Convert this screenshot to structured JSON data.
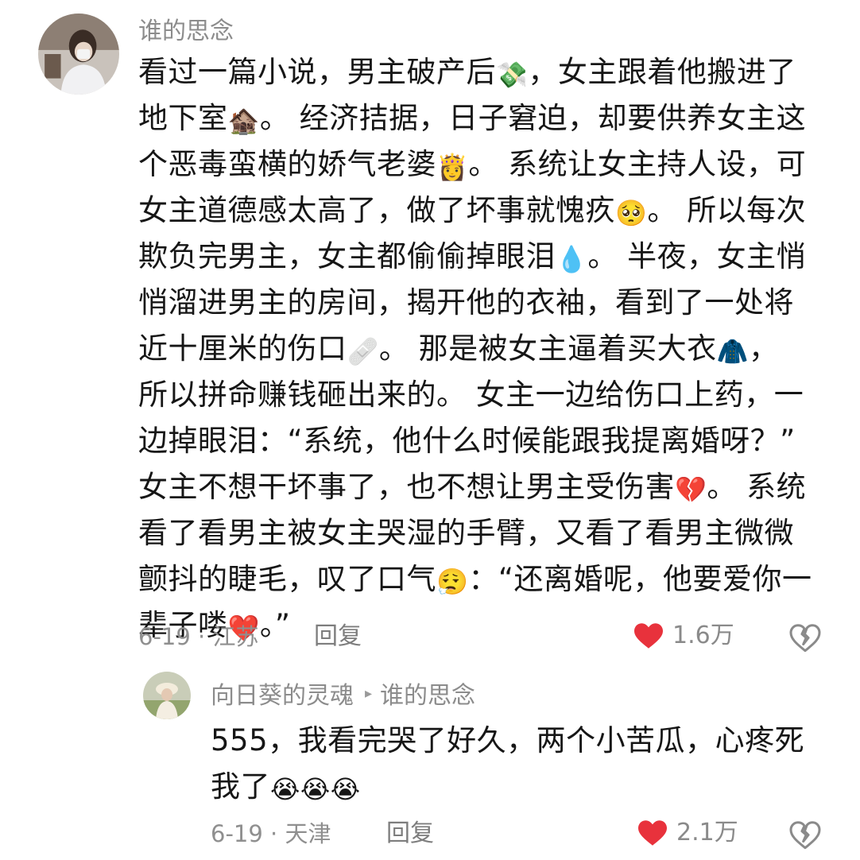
{
  "main_comment": {
    "username": "谁的思念",
    "lines": [
      [
        "看过一篇小说，男主破产后",
        "💸",
        "，女主跟着他搬进了"
      ],
      [
        "地下室",
        "🏚️",
        "。 经济拮据，日子窘迫，却要供养女主这"
      ],
      [
        "个恶毒蛮横的娇气老婆",
        "👸",
        "。 系统让女主持人设，可"
      ],
      [
        "女主道德感太高了，做了坏事就愧疚",
        "🥺",
        "。 所以每次"
      ],
      [
        "欺负完男主，女主都偷偷掉眼泪",
        "💧",
        "。 半夜，女主悄"
      ],
      [
        "悄溜进男主的房间，揭开他的衣袖，看到了一处将"
      ],
      [
        "近十厘米的伤口",
        "🩹",
        "。 那是被女主逼着买大衣",
        "🧥",
        "，"
      ],
      [
        "所以拼命赚钱砸出来的。 女主一边给伤口上药，一"
      ],
      [
        "边掉眼泪：“系统，他什么时候能跟我提离婚呀？”"
      ],
      [
        "女主不想干坏事了，也不想让男主受伤害",
        "💔",
        "。 系统"
      ],
      [
        "看了看男主被女主哭湿的手臂，又看了看男主微微"
      ],
      [
        "颤抖的睫毛，叹了口气",
        "😮‍💨",
        "：“还离婚呢，他要爱你一"
      ],
      [
        "辈子喽",
        "❤️",
        "。”"
      ]
    ],
    "date_location": "6-19 · 江苏",
    "reply_label": "回复",
    "like_count": "1.6万"
  },
  "reply_comment": {
    "username": "向日葵的灵魂",
    "reply_arrow": "▸",
    "reply_to": "谁的思念",
    "lines": [
      [
        "555，我看完哭了好久，两个小苦瓜，心疼死"
      ],
      [
        "我了",
        "😭😭😭"
      ]
    ],
    "date_location": "6-19 · 天津",
    "reply_label": "回复",
    "like_count": "2.1万"
  },
  "colors": {
    "like_heart": "#e8323c",
    "meta_text": "#8f8f8f",
    "body_text": "#161616"
  },
  "icons": {
    "like": "heart-icon",
    "dislike": "broken-heart-outline-icon"
  }
}
